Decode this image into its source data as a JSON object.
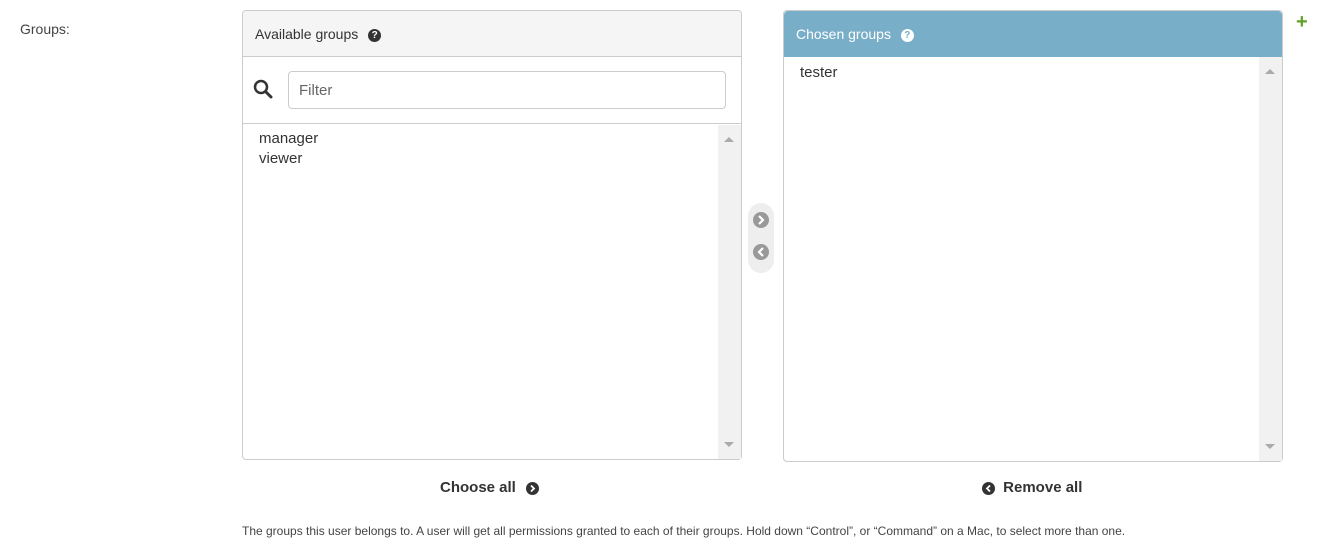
{
  "field": {
    "label": "Groups:"
  },
  "available": {
    "title": "Available groups",
    "help_icon": "question-circle-icon",
    "filter": {
      "placeholder": "Filter",
      "value": ""
    },
    "options": [
      "manager",
      "viewer"
    ]
  },
  "chosen": {
    "title": "Chosen groups",
    "help_icon": "question-circle-icon",
    "options": [
      "tester"
    ]
  },
  "actions": {
    "choose_all": "Choose all",
    "remove_all": "Remove all",
    "add_icon": "arrow-right-circle-icon",
    "remove_icon": "arrow-left-circle-icon",
    "add_related_icon": "plus-icon"
  },
  "help_text": "The groups this user belongs to. A user will get all permissions granted to each of their groups. Hold down “Control”, or “Command” on a Mac, to select more than one.",
  "colors": {
    "chosen_header": "#79aec8",
    "add_link": "#5fa225",
    "chooser_bg": "#eeeeee"
  }
}
